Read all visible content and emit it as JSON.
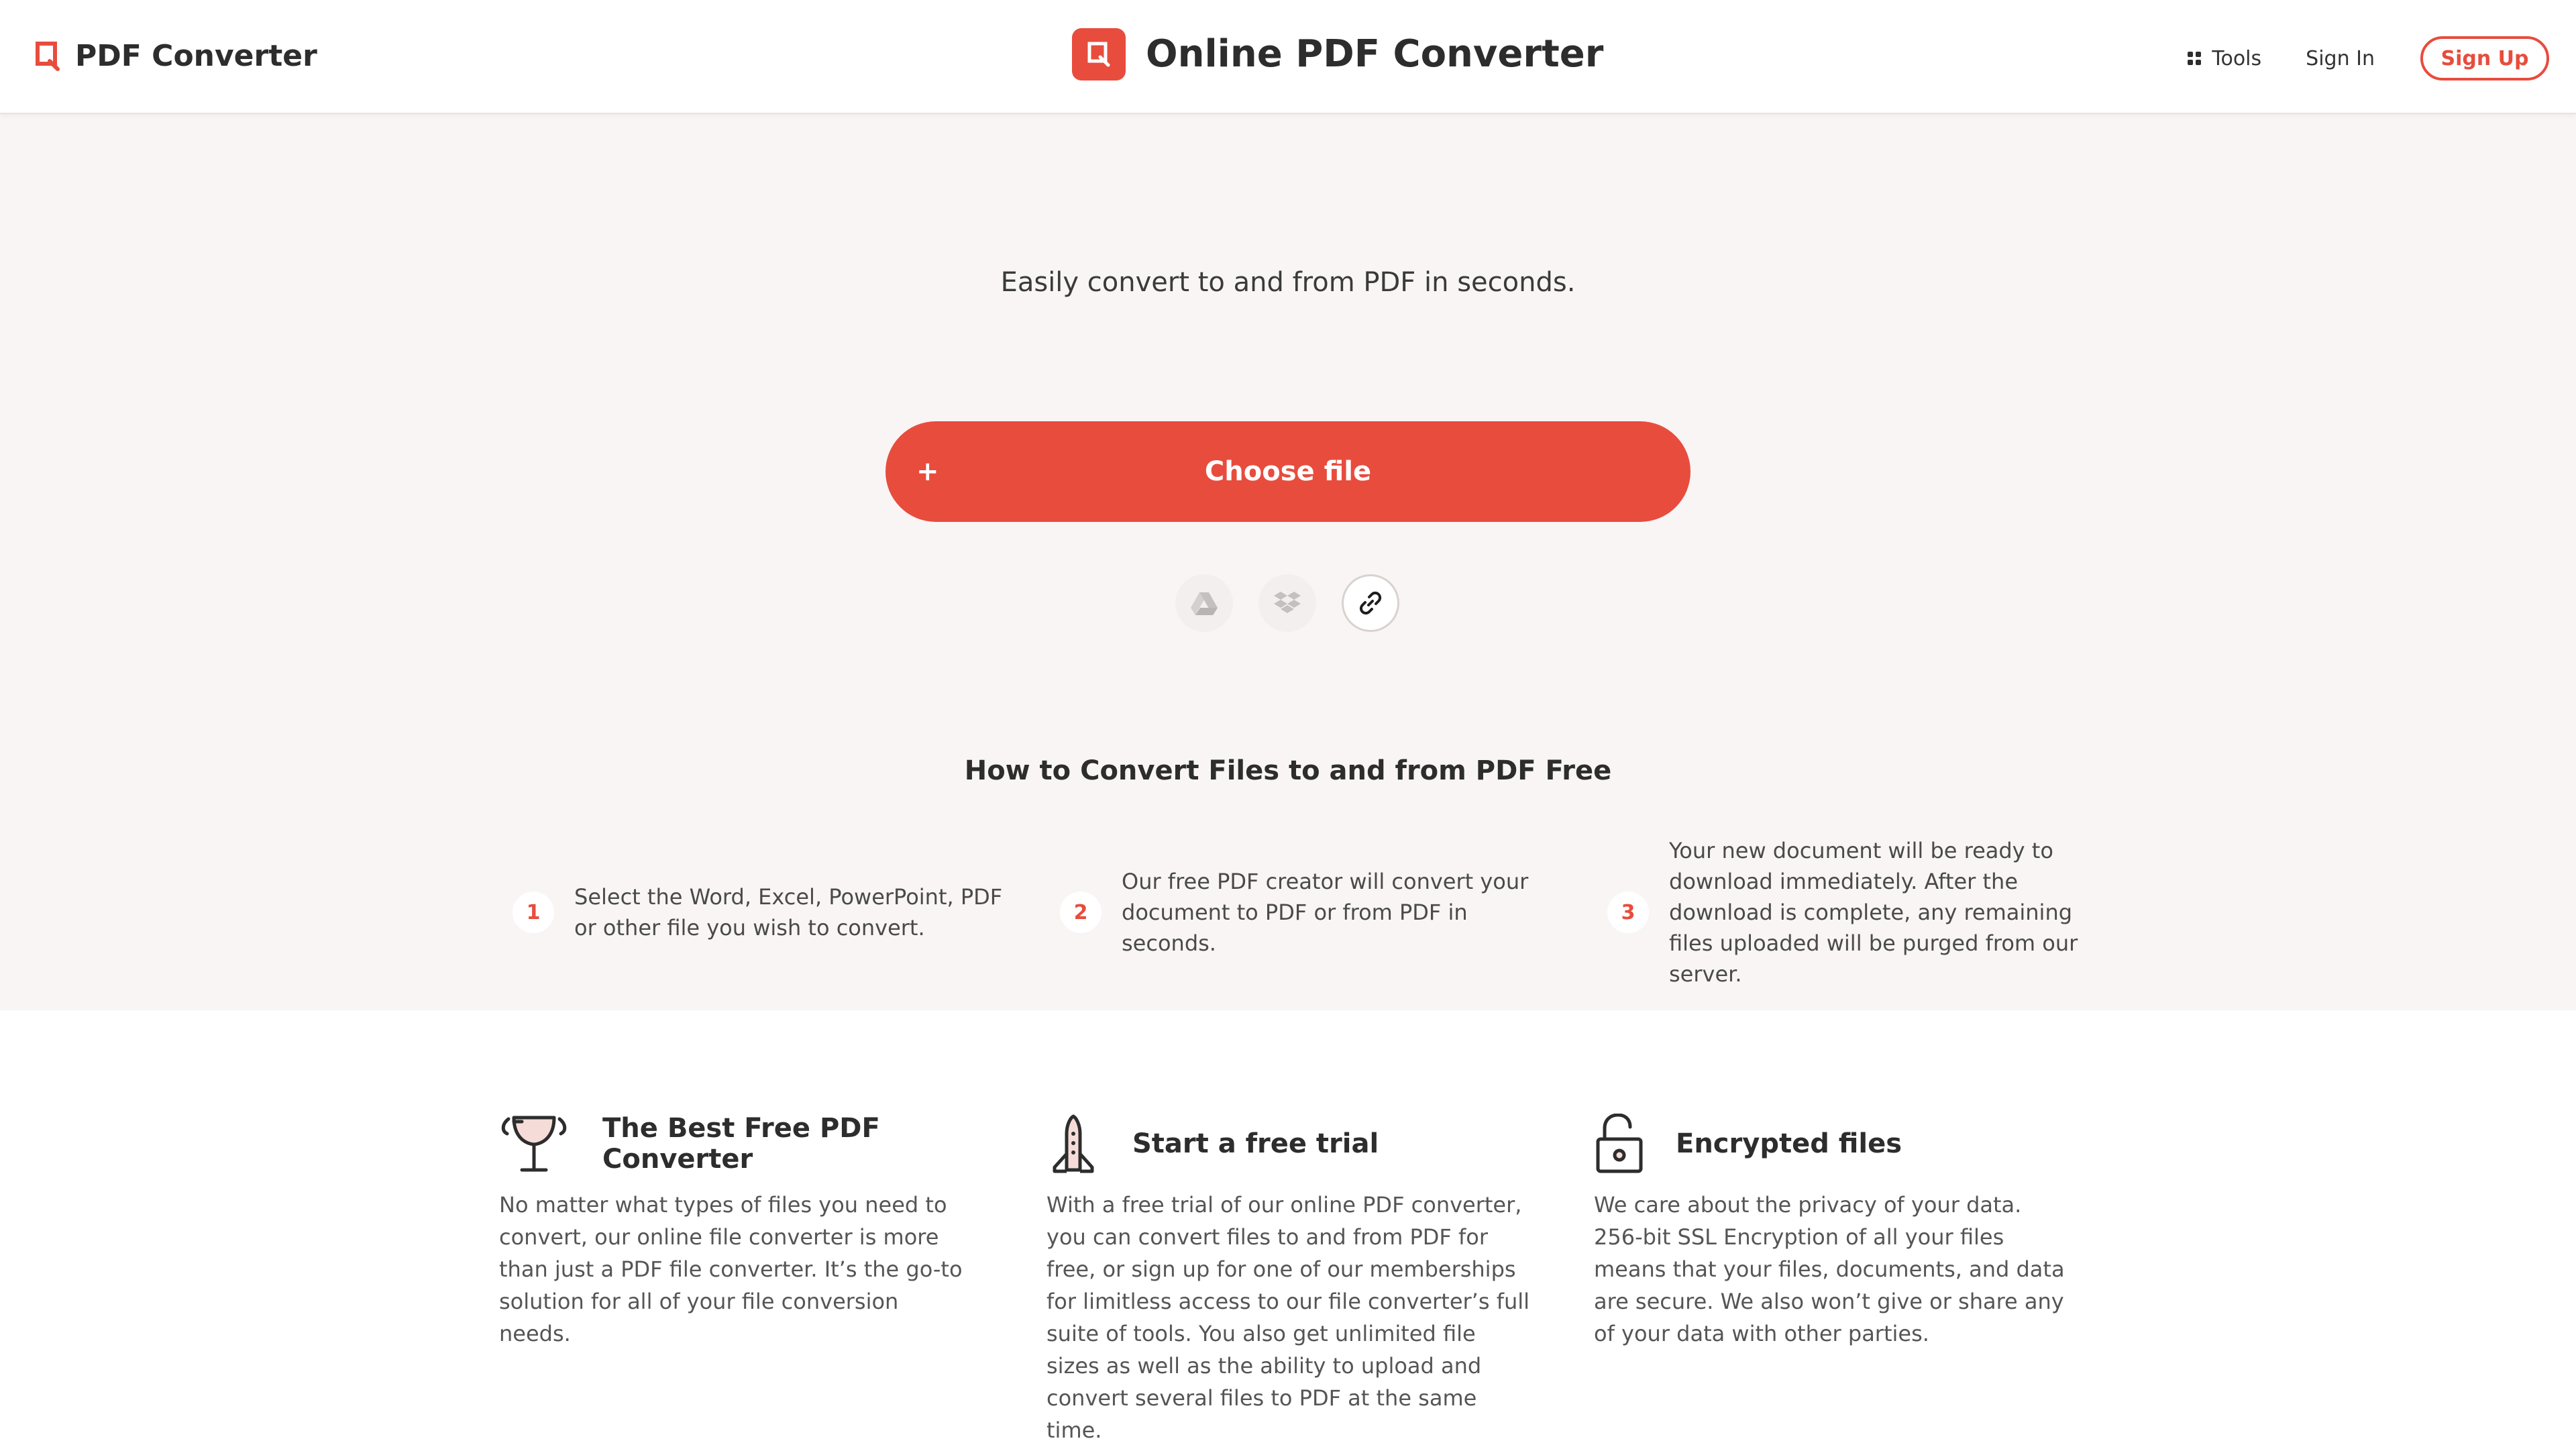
{
  "header": {
    "brand_left": "PDF Converter",
    "brand_center": "Online PDF Converter",
    "nav": {
      "tools": "Tools",
      "sign_in": "Sign In",
      "sign_up": "Sign Up"
    }
  },
  "hero": {
    "tagline": "Easily convert to and from PDF in seconds.",
    "choose_file": {
      "icon": "+",
      "label": "Choose file"
    },
    "sources": [
      "google-drive-icon",
      "dropbox-icon",
      "link-icon"
    ]
  },
  "how_to": {
    "title": "How to Convert Files to and from PDF Free",
    "steps": [
      {
        "number": "1",
        "text": "Select the Word, Excel, PowerPoint, PDF or other file you wish to convert."
      },
      {
        "number": "2",
        "text": "Our free PDF creator will convert your document to PDF or from PDF in seconds."
      },
      {
        "number": "3",
        "text": "Your new document will be ready to download immediately. After the download is complete, any remaining files uploaded will be purged from our server."
      }
    ]
  },
  "features": [
    {
      "icon": "trophy-icon",
      "title": "The Best Free PDF Converter",
      "body": "No matter what types of files you need to convert, our online file converter is more than just a PDF file converter. It’s the go-to solution for all of your file conversion needs."
    },
    {
      "icon": "rocket-icon",
      "title": "Start a free trial",
      "body": "With a free trial of our online PDF converter, you can convert files to and from PDF for free, or sign up for one of our memberships for limitless access to our file converter’s full suite of tools. You also get unlimited file sizes as well as the ability to upload and convert several files to PDF at the same time."
    },
    {
      "icon": "lock-icon",
      "title": "Encrypted files",
      "body": "We care about the privacy of your data. 256-bit SSL Encryption of all your files means that your files, documents, and data are secure. We also won’t give or share any of your data with other parties."
    }
  ],
  "colors": {
    "accent": "#e84c3d",
    "hero_bg": "#f8f5f4",
    "text": "#2d2d2d"
  }
}
